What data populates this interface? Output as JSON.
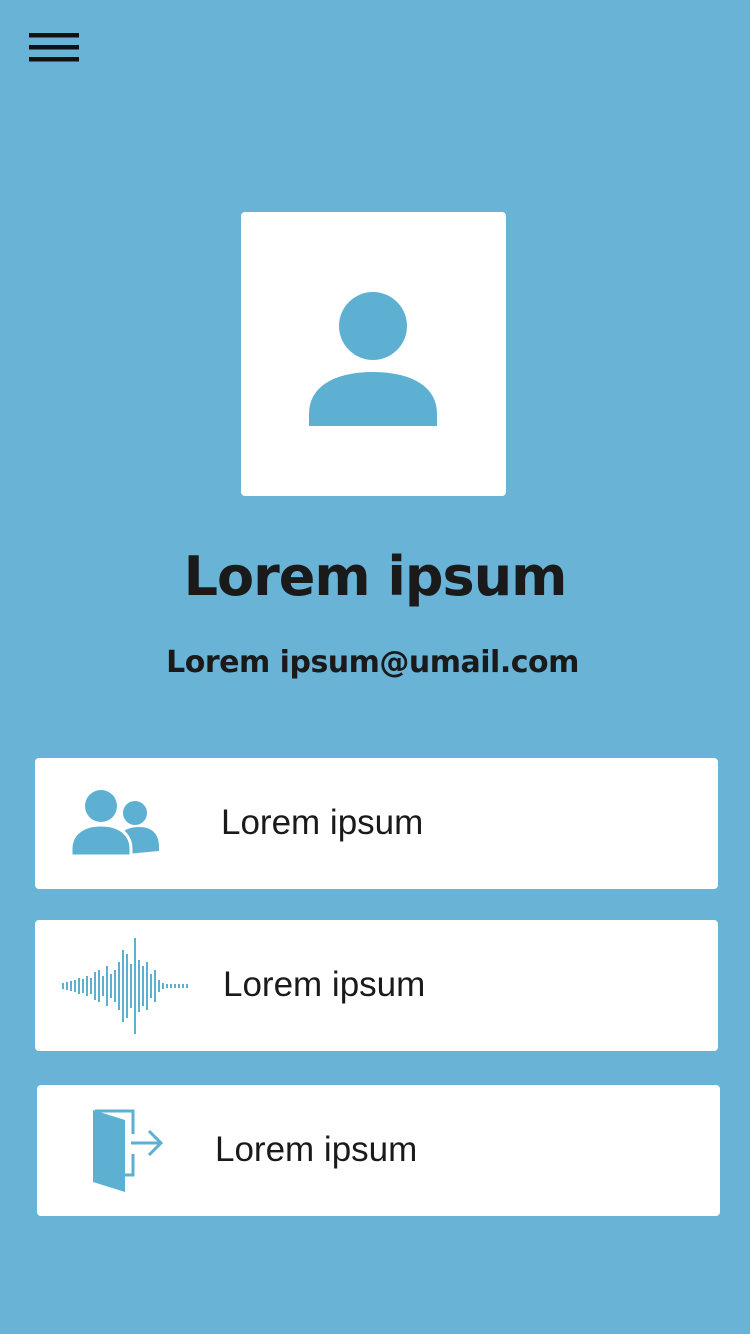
{
  "header": {
    "menu_icon": "hamburger-menu-icon"
  },
  "profile": {
    "avatar_icon": "user-icon",
    "name": "Lorem ipsum",
    "email": "Lorem ipsum@umail.com"
  },
  "menu_items": [
    {
      "icon": "users-group-icon",
      "label": "Lorem ipsum"
    },
    {
      "icon": "sound-wave-icon",
      "label": "Lorem ipsum"
    },
    {
      "icon": "logout-door-icon",
      "label": "Lorem ipsum"
    }
  ],
  "colors": {
    "background": "#69b3d6",
    "icon_accent": "#5eb0d3",
    "card": "#ffffff",
    "text": "#1a1a1a"
  }
}
